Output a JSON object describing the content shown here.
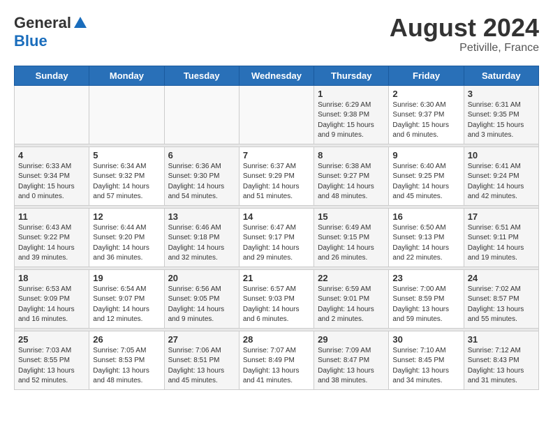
{
  "header": {
    "logo_general": "General",
    "logo_blue": "Blue",
    "month_title": "August 2024",
    "location": "Petiville, France"
  },
  "weekdays": [
    "Sunday",
    "Monday",
    "Tuesday",
    "Wednesday",
    "Thursday",
    "Friday",
    "Saturday"
  ],
  "weeks": [
    [
      {
        "day": "",
        "info": ""
      },
      {
        "day": "",
        "info": ""
      },
      {
        "day": "",
        "info": ""
      },
      {
        "day": "",
        "info": ""
      },
      {
        "day": "1",
        "info": "Sunrise: 6:29 AM\nSunset: 9:38 PM\nDaylight: 15 hours\nand 9 minutes."
      },
      {
        "day": "2",
        "info": "Sunrise: 6:30 AM\nSunset: 9:37 PM\nDaylight: 15 hours\nand 6 minutes."
      },
      {
        "day": "3",
        "info": "Sunrise: 6:31 AM\nSunset: 9:35 PM\nDaylight: 15 hours\nand 3 minutes."
      }
    ],
    [
      {
        "day": "4",
        "info": "Sunrise: 6:33 AM\nSunset: 9:34 PM\nDaylight: 15 hours\nand 0 minutes."
      },
      {
        "day": "5",
        "info": "Sunrise: 6:34 AM\nSunset: 9:32 PM\nDaylight: 14 hours\nand 57 minutes."
      },
      {
        "day": "6",
        "info": "Sunrise: 6:36 AM\nSunset: 9:30 PM\nDaylight: 14 hours\nand 54 minutes."
      },
      {
        "day": "7",
        "info": "Sunrise: 6:37 AM\nSunset: 9:29 PM\nDaylight: 14 hours\nand 51 minutes."
      },
      {
        "day": "8",
        "info": "Sunrise: 6:38 AM\nSunset: 9:27 PM\nDaylight: 14 hours\nand 48 minutes."
      },
      {
        "day": "9",
        "info": "Sunrise: 6:40 AM\nSunset: 9:25 PM\nDaylight: 14 hours\nand 45 minutes."
      },
      {
        "day": "10",
        "info": "Sunrise: 6:41 AM\nSunset: 9:24 PM\nDaylight: 14 hours\nand 42 minutes."
      }
    ],
    [
      {
        "day": "11",
        "info": "Sunrise: 6:43 AM\nSunset: 9:22 PM\nDaylight: 14 hours\nand 39 minutes."
      },
      {
        "day": "12",
        "info": "Sunrise: 6:44 AM\nSunset: 9:20 PM\nDaylight: 14 hours\nand 36 minutes."
      },
      {
        "day": "13",
        "info": "Sunrise: 6:46 AM\nSunset: 9:18 PM\nDaylight: 14 hours\nand 32 minutes."
      },
      {
        "day": "14",
        "info": "Sunrise: 6:47 AM\nSunset: 9:17 PM\nDaylight: 14 hours\nand 29 minutes."
      },
      {
        "day": "15",
        "info": "Sunrise: 6:49 AM\nSunset: 9:15 PM\nDaylight: 14 hours\nand 26 minutes."
      },
      {
        "day": "16",
        "info": "Sunrise: 6:50 AM\nSunset: 9:13 PM\nDaylight: 14 hours\nand 22 minutes."
      },
      {
        "day": "17",
        "info": "Sunrise: 6:51 AM\nSunset: 9:11 PM\nDaylight: 14 hours\nand 19 minutes."
      }
    ],
    [
      {
        "day": "18",
        "info": "Sunrise: 6:53 AM\nSunset: 9:09 PM\nDaylight: 14 hours\nand 16 minutes."
      },
      {
        "day": "19",
        "info": "Sunrise: 6:54 AM\nSunset: 9:07 PM\nDaylight: 14 hours\nand 12 minutes."
      },
      {
        "day": "20",
        "info": "Sunrise: 6:56 AM\nSunset: 9:05 PM\nDaylight: 14 hours\nand 9 minutes."
      },
      {
        "day": "21",
        "info": "Sunrise: 6:57 AM\nSunset: 9:03 PM\nDaylight: 14 hours\nand 6 minutes."
      },
      {
        "day": "22",
        "info": "Sunrise: 6:59 AM\nSunset: 9:01 PM\nDaylight: 14 hours\nand 2 minutes."
      },
      {
        "day": "23",
        "info": "Sunrise: 7:00 AM\nSunset: 8:59 PM\nDaylight: 13 hours\nand 59 minutes."
      },
      {
        "day": "24",
        "info": "Sunrise: 7:02 AM\nSunset: 8:57 PM\nDaylight: 13 hours\nand 55 minutes."
      }
    ],
    [
      {
        "day": "25",
        "info": "Sunrise: 7:03 AM\nSunset: 8:55 PM\nDaylight: 13 hours\nand 52 minutes."
      },
      {
        "day": "26",
        "info": "Sunrise: 7:05 AM\nSunset: 8:53 PM\nDaylight: 13 hours\nand 48 minutes."
      },
      {
        "day": "27",
        "info": "Sunrise: 7:06 AM\nSunset: 8:51 PM\nDaylight: 13 hours\nand 45 minutes."
      },
      {
        "day": "28",
        "info": "Sunrise: 7:07 AM\nSunset: 8:49 PM\nDaylight: 13 hours\nand 41 minutes."
      },
      {
        "day": "29",
        "info": "Sunrise: 7:09 AM\nSunset: 8:47 PM\nDaylight: 13 hours\nand 38 minutes."
      },
      {
        "day": "30",
        "info": "Sunrise: 7:10 AM\nSunset: 8:45 PM\nDaylight: 13 hours\nand 34 minutes."
      },
      {
        "day": "31",
        "info": "Sunrise: 7:12 AM\nSunset: 8:43 PM\nDaylight: 13 hours\nand 31 minutes."
      }
    ]
  ]
}
